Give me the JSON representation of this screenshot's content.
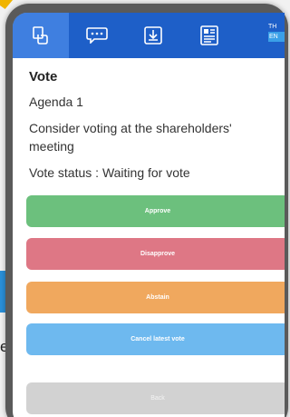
{
  "background": {
    "partial_text": "e."
  },
  "header": {
    "tabs": [
      {
        "icon": "vote-hand-icon",
        "active": true
      },
      {
        "icon": "chat-bubble-icon",
        "active": false
      },
      {
        "icon": "download-icon",
        "active": false
      },
      {
        "icon": "document-icon",
        "active": false
      }
    ],
    "lang_top": "TH",
    "lang_bottom": "EN"
  },
  "content": {
    "title": "Vote",
    "agenda": "Agenda 1",
    "description": "Consider voting at the shareholders' meeting",
    "status": "Vote status : Waiting for vote"
  },
  "actions": {
    "approve": "Approve",
    "disapprove": "Disapprove",
    "abstain": "Abstain",
    "cancel": "Cancel latest vote",
    "back": "Back"
  },
  "colors": {
    "header": "#1e5fc8",
    "approve": "#6cc07d",
    "disapprove": "#de7785",
    "abstain": "#f0a85e",
    "cancel": "#6eb9ef",
    "back": "#d2d2d2"
  }
}
